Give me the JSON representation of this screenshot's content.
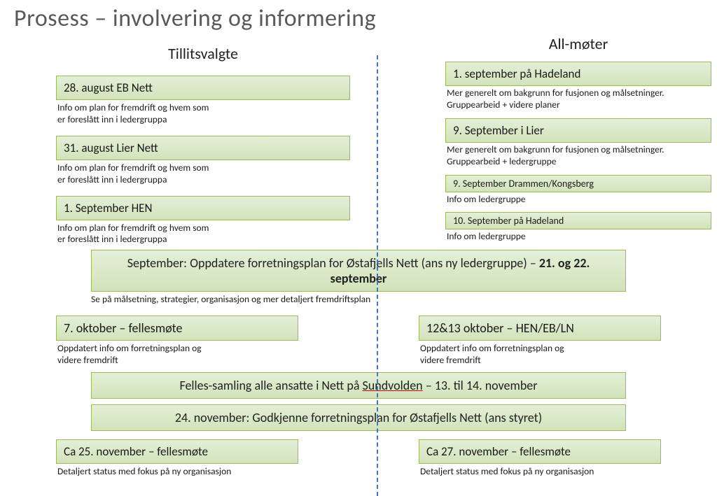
{
  "title": "Prosess – involvering og informering",
  "left": {
    "heading": "Tillitsvalgte",
    "items": [
      {
        "label": "28. august EB Nett",
        "sub": "Info om plan for fremdrift og hvem som\ner foreslått inn i ledergruppa"
      },
      {
        "label": "31. august Lier Nett",
        "sub": "Info om plan for fremdrift og hvem som\ner foreslått inn i ledergruppa"
      },
      {
        "label": "1. September HEN",
        "sub": "Info om plan for fremdrift og hvem som\ner foreslått inn i ledergruppa"
      }
    ]
  },
  "right": {
    "heading": "All-møter",
    "items": [
      {
        "label": "1. september på Hadeland",
        "sub": "Mer generelt om bakgrunn for fusjonen og målsetninger. Gruppearbeid + videre planer"
      },
      {
        "label": "9. September i Lier",
        "sub": "Mer generelt om bakgrunn for fusjonen og målsetninger. Gruppearbeid + ledergruppe"
      },
      {
        "label": "9. September  Drammen/Kongsberg",
        "sub": "Info om ledergruppe",
        "small": true
      },
      {
        "label": "10. September  på Hadeland",
        "sub": "Info om ledergruppe",
        "small": true
      }
    ]
  },
  "wide1": {
    "prefix": "September: Oppdatere forretningsplan for Østafjells Nett (ans ny ledergruppe) – ",
    "bold": "21. og 22. september",
    "sub": "Se på målsetning, strategier, organisasjon og mer detaljert fremdriftsplan"
  },
  "row2": {
    "l": {
      "label": "7. oktober – fellesmøte",
      "sub": "Oppdatert info om forretningsplan og\nvidere fremdrift"
    },
    "r": {
      "label": "12&13 oktober – HEN/EB/LN",
      "sub": "Oppdatert info om forretningsplan og\nvidere fremdrift"
    }
  },
  "wide2": {
    "pre": "Felles-samling  alle ansatte i Nett på ",
    "u": "Sundvolden",
    "post": " – 13. til 14. november"
  },
  "wide3": "24. november: Godkjenne forretningsplan for Østafjells Nett (ans styret)",
  "row3": {
    "l": {
      "label": "Ca 25. november – fellesmøte",
      "sub": "Detaljert status med fokus på ny organisasjon"
    },
    "r": {
      "label": "Ca 27. november – fellesmøte",
      "sub": "Detaljert status med fokus på ny organisasjon"
    }
  }
}
